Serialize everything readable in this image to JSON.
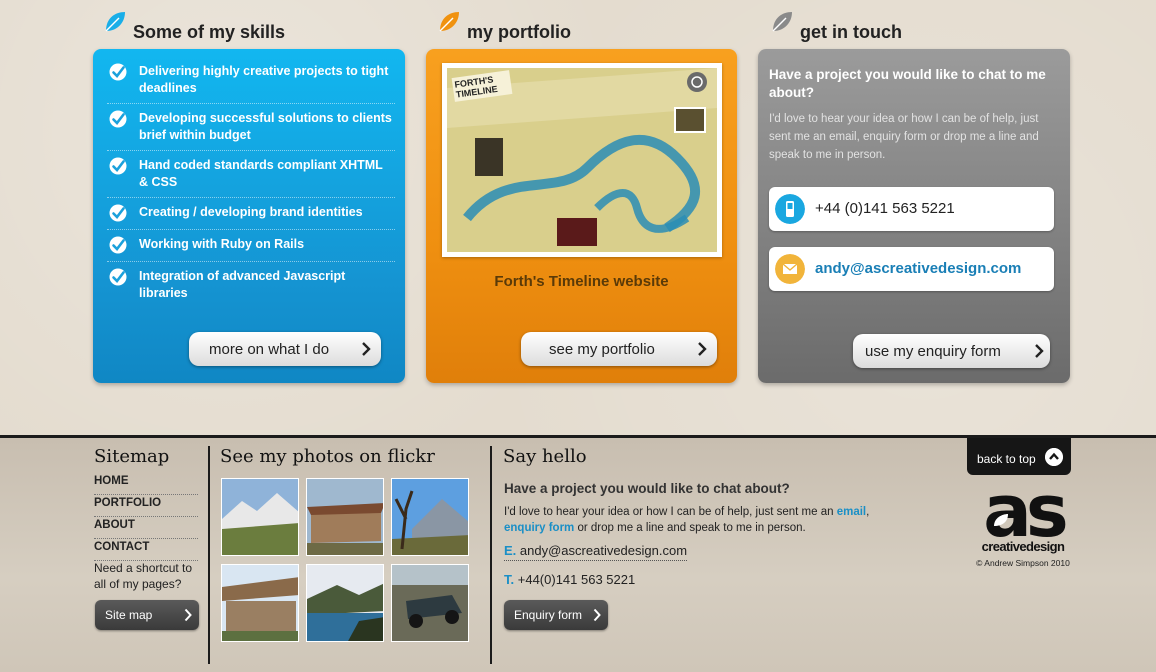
{
  "skills_section": {
    "title": "Some of my skills",
    "items": [
      "Delivering highly creative projects to tight deadlines",
      "Developing successful solutions to clients brief within budget",
      "Hand coded standards compliant XHTML & CSS",
      "Creating / developing brand identities",
      "Working with Ruby on Rails",
      "Integration of advanced Javascript libraries"
    ],
    "button_label": "more on what I do"
  },
  "portfolio_section": {
    "title": "my portfolio",
    "screenshot_title": "FORTH'S TIMELINE",
    "caption": "Forth's Timeline website",
    "button_label": "see my portfolio"
  },
  "contact_section": {
    "title": "get in touch",
    "heading": "Have a project you would like to chat to me about?",
    "text": "I'd love to hear your idea or how I can be of help, just sent me an email, enquiry form or drop me a line and speak to me in person.",
    "phone": "+44 (0)141 563 5221",
    "email": "andy@ascreativedesign.com",
    "button_label": "use my enquiry form"
  },
  "sitemap": {
    "title": "Sitemap",
    "links": [
      "HOME",
      "PORTFOLIO",
      "ABOUT",
      "CONTACT"
    ],
    "note": "Need a shortcut to all of my pages?",
    "button_label": "Site map"
  },
  "flickr": {
    "title": "See my photos on flickr",
    "photos": [
      "mountain-meadow",
      "stone-hut",
      "olive-tree-mountain",
      "ruined-house",
      "lake-shore",
      "jeep-offroad"
    ]
  },
  "say_hello": {
    "title": "Say hello",
    "question": "Have a project you would like to chat about?",
    "text_before_email": "I'd love to hear your idea or how I can be of help, just sent me an ",
    "email_link": "email",
    "comma": ",",
    "enquiry_link": "enquiry form",
    "text_after": " or drop me a line and speak to me in person.",
    "email_key": "E.",
    "email_value": "andy@ascreativedesign.com",
    "phone_key": "T.",
    "phone_value": "+44(0)141 563 5221",
    "button_label": "Enquiry form"
  },
  "brand": {
    "back_to_top": "back to top",
    "logo_text": "as",
    "logo_sub": "creativedesign",
    "copyright": "© Andrew Simpson 2010"
  },
  "colors": {
    "blue_panel": "#1594d2",
    "orange_panel": "#ef8f10",
    "gray_panel": "#7f7f7f",
    "link": "#1a8fc6"
  }
}
